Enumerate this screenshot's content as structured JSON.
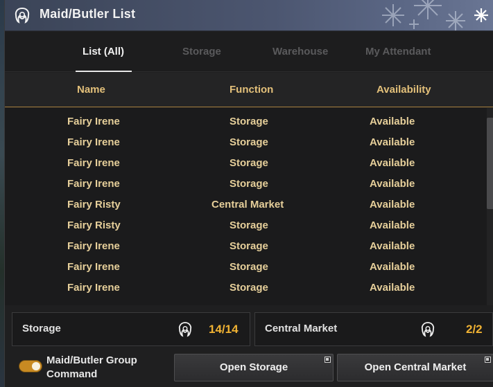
{
  "window": {
    "title": "Maid/Butler List"
  },
  "tabs": [
    {
      "label": "List (All)",
      "active": true
    },
    {
      "label": "Storage",
      "active": false
    },
    {
      "label": "Warehouse",
      "active": false
    },
    {
      "label": "My Attendant",
      "active": false
    }
  ],
  "table": {
    "headers": [
      "Name",
      "Function",
      "Availability"
    ],
    "rows": [
      [
        "Fairy Irene",
        "Storage",
        "Available"
      ],
      [
        "Fairy Irene",
        "Storage",
        "Available"
      ],
      [
        "Fairy Irene",
        "Storage",
        "Available"
      ],
      [
        "Fairy Irene",
        "Storage",
        "Available"
      ],
      [
        "Fairy Risty",
        "Central Market",
        "Available"
      ],
      [
        "Fairy Risty",
        "Storage",
        "Available"
      ],
      [
        "Fairy Irene",
        "Storage",
        "Available"
      ],
      [
        "Fairy Irene",
        "Storage",
        "Available"
      ],
      [
        "Fairy Irene",
        "Storage",
        "Available"
      ]
    ]
  },
  "summary": {
    "storage": {
      "label": "Storage",
      "count": "14/14"
    },
    "market": {
      "label": "Central Market",
      "count": "2/2"
    }
  },
  "footer": {
    "group_toggle_label_line1": "Maid/Butler Group",
    "group_toggle_label_line2": "Command",
    "group_toggle_on": true,
    "open_storage_label": "Open Storage",
    "open_market_label": "Open Central Market"
  },
  "colors": {
    "accent_gold": "#e6cf9a",
    "header_gold": "#e3c07a",
    "count_orange": "#f0b233",
    "titlebar": "#4c5670"
  },
  "icons": {
    "title": "maid-icon",
    "close": "snowflake-close-icon",
    "panel": "maid-icon"
  }
}
